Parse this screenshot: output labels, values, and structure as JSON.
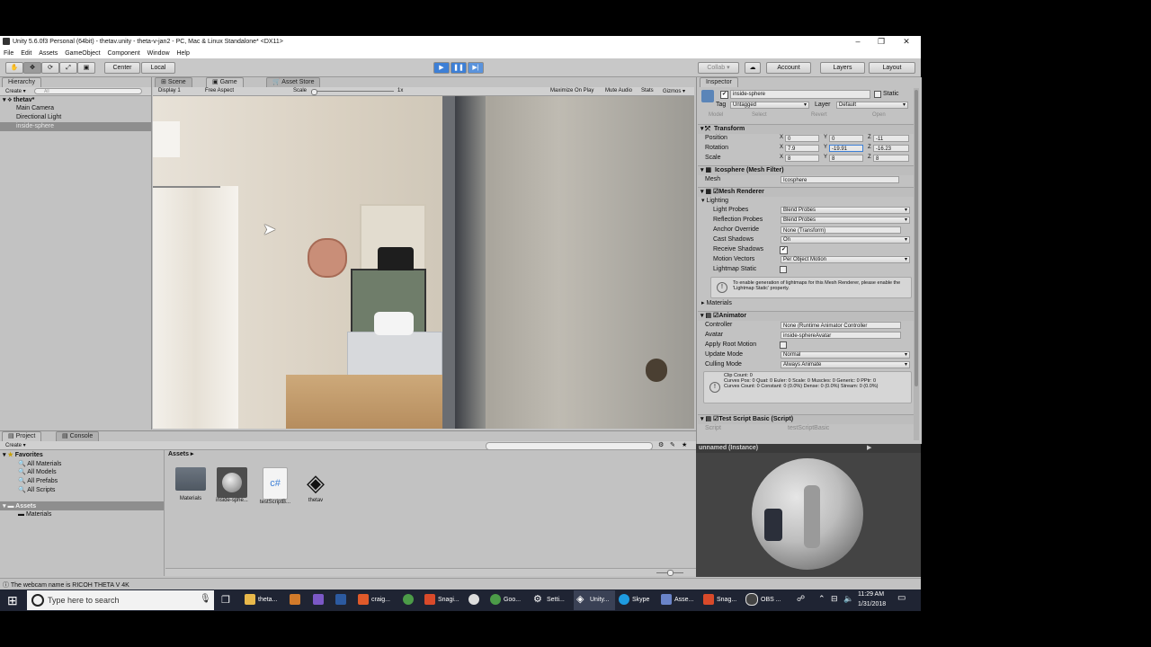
{
  "window": {
    "title": "Unity 5.6.0f3 Personal (64bit) - thetav.unity - theta-v-jan2 - PC, Mac & Linux Standalone* <DX11>"
  },
  "menu": [
    "File",
    "Edit",
    "Assets",
    "GameObject",
    "Component",
    "Window",
    "Help"
  ],
  "toolbar": {
    "center_label": "Center",
    "local_label": "Local",
    "collab_label": "Collab ▾",
    "account_label": "Account",
    "layers_label": "Layers",
    "layout_label": "Layout"
  },
  "hierarchy": {
    "tab": "Hierarchy",
    "create": "Create ▾",
    "search_placeholder": "All",
    "scene": "thetav*",
    "items": [
      "Main Camera",
      "Directional Light",
      "inside-sphere"
    ]
  },
  "scene_tabs": [
    "Scene",
    "Game",
    "Asset Store"
  ],
  "game_bar": {
    "display": "Display 1",
    "aspect": "Free Aspect",
    "scale_label": "Scale",
    "scale_value": "1x",
    "maximize": "Maximize On Play",
    "mute": "Mute Audio",
    "stats": "Stats",
    "gizmos": "Gizmos ▾"
  },
  "inspector": {
    "tab": "Inspector",
    "object_name": "inside-sphere",
    "static_label": "Static",
    "tag_label": "Tag",
    "tag_value": "Untagged",
    "layer_label": "Layer",
    "layer_value": "Default",
    "model_label": "Model",
    "select_label": "Select",
    "revert_label": "Revert",
    "open_label": "Open",
    "transform": {
      "title": "Transform",
      "position_label": "Position",
      "rotation_label": "Rotation",
      "scale_label": "Scale",
      "position": [
        "0",
        "0",
        "-11"
      ],
      "rotation": [
        "7.9",
        "-19.91",
        "-16.23"
      ],
      "scale": [
        "8",
        "8",
        "8"
      ]
    },
    "mesh_filter": {
      "title": "Icosphere (Mesh Filter)",
      "mesh_label": "Mesh",
      "mesh_value": "Icosphere"
    },
    "mesh_renderer": {
      "title": "Mesh Renderer",
      "lighting": "Lighting",
      "light_probes_label": "Light Probes",
      "light_probes": "Blend Probes",
      "reflection_probes_label": "Reflection Probes",
      "reflection_probes": "Blend Probes",
      "anchor_override_label": "Anchor Override",
      "anchor_override": "None (Transform)",
      "cast_shadows_label": "Cast Shadows",
      "cast_shadows": "On",
      "receive_shadows_label": "Receive Shadows",
      "motion_vectors_label": "Motion Vectors",
      "motion_vectors": "Per Object Motion",
      "lightmap_static_label": "Lightmap Static",
      "info": "To enable generation of lightmaps for this Mesh Renderer, please enable the 'Lightmap Static' property."
    },
    "materials_label": "Materials",
    "animator": {
      "title": "Animator",
      "controller_label": "Controller",
      "controller": "None (Runtime Animator Controller",
      "avatar_label": "Avatar",
      "avatar": "inside-sphereAvatar",
      "apply_root_label": "Apply Root Motion",
      "update_mode_label": "Update Mode",
      "update_mode": "Normal",
      "culling_mode_label": "Culling Mode",
      "culling_mode": "Always Animate",
      "info": "Clip Count: 0\nCurves Pos: 0 Quat: 0 Euler: 0 Scale: 0 Muscles: 0 Generic: 0 PPtr: 0\nCurves Count: 0 Constant: 0 (0.0%) Dense: 0 (0.0%) Stream: 0 (0.0%)"
    },
    "script_comp": {
      "title": "Test Script Basic (Script)",
      "script_label": "Script",
      "script_value": "testScriptBasic"
    }
  },
  "preview": {
    "title": "unnamed (Instance)"
  },
  "project": {
    "tabs": [
      "Project",
      "Console"
    ],
    "create": "Create ▾",
    "favorites": "Favorites",
    "favorite_items": [
      "All Materials",
      "All Models",
      "All Prefabs",
      "All Scripts"
    ],
    "assets_root": "Assets",
    "asset_folders": [
      "Materials"
    ],
    "breadcrumb": "Assets ▸",
    "assets": [
      "Materials",
      "inside-sphe...",
      "testScriptB...",
      "thetav"
    ]
  },
  "status_bar": {
    "message": "The webcam name is RICOH THETA V 4K"
  },
  "taskbar": {
    "search_placeholder": "Type here to search",
    "apps": [
      "theta...",
      "",
      "",
      "",
      "craig...",
      "",
      "Snagi...",
      "",
      "Goo...",
      "Setti...",
      "Unity...",
      "Skype",
      "Asse...",
      "Snag...",
      "OBS ..."
    ],
    "time": "11:29 AM",
    "date": "1/31/2018"
  }
}
